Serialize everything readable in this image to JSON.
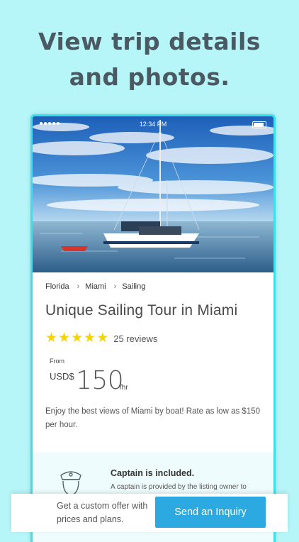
{
  "headline": [
    "View trip details",
    "and photos."
  ],
  "statusbar": {
    "time": "12:34 PM"
  },
  "icons": {
    "breadcrumb_separator": "chevron-right-icon",
    "star": "star-icon",
    "captain": "captain-icon"
  },
  "breadcrumb": [
    "Florida",
    "Miami",
    "Sailing"
  ],
  "listing": {
    "title": "Unique Sailing Tour in Miami",
    "rating": 5,
    "reviews": "25 reviews",
    "price": {
      "from_label": "From",
      "currency": "USD$",
      "amount": "150",
      "unit": "/hr"
    },
    "description": "Enjoy the best views of Miami by boat! Rate as low as $150 per hour."
  },
  "captain": {
    "title": "Captain is included.",
    "text": "A captain is provided by the listing owner to"
  },
  "bottom_bar": {
    "offer_text": "Get a custom offer with prices and plans.",
    "button_label": "Send an Inquiry"
  },
  "colors": {
    "background": "#b6f6f9",
    "accent": "#2ba9e0",
    "frame": "#3ce0e8",
    "star": "#f5d400",
    "headline": "#4b5a62"
  }
}
